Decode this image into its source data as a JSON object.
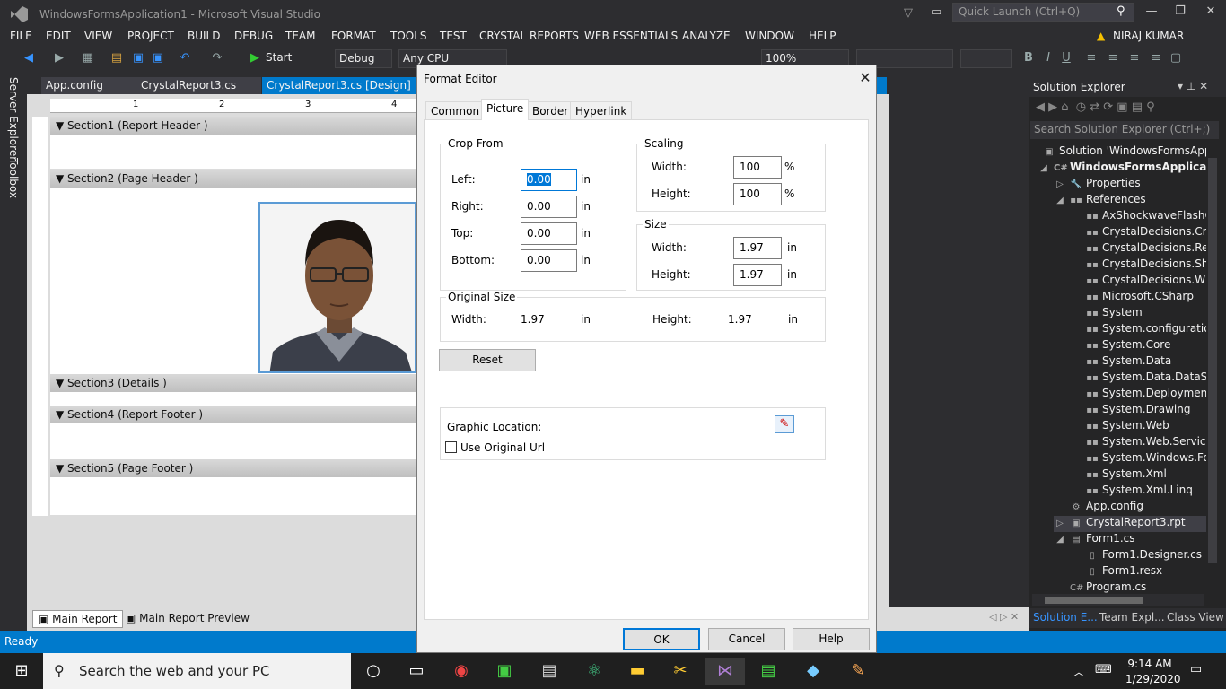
{
  "window": {
    "title": "WindowsFormsApplication1 - Microsoft Visual Studio",
    "quick_launch": "Quick Launch (Ctrl+Q)",
    "user": "NIRAJ KUMAR"
  },
  "menu": [
    "FILE",
    "EDIT",
    "VIEW",
    "PROJECT",
    "BUILD",
    "DEBUG",
    "TEAM",
    "FORMAT",
    "TOOLS",
    "TEST",
    "CRYSTAL REPORTS",
    "WEB ESSENTIALS",
    "ANALYZE",
    "WINDOW",
    "HELP"
  ],
  "toolbar": {
    "start": "Start",
    "config": "Debug",
    "platform": "Any CPU",
    "zoom": "100%"
  },
  "left_tabs": [
    "Server Explorer",
    "Toolbox"
  ],
  "doc_tabs": [
    "App.config",
    "CrystalReport3.cs",
    "CrystalReport3.cs [Design]"
  ],
  "ruler": [
    "1",
    "2",
    "3",
    "4"
  ],
  "sections": [
    "Section1 (Report Header  )",
    "Section2 (Page Header  )",
    "Section3 (Details  )",
    "Section4 (Report Footer  )",
    "Section5 (Page Footer  )"
  ],
  "bottom_tabs": [
    "Main Report",
    "Main Report Preview"
  ],
  "solution_explorer": {
    "title": "Solution Explorer",
    "search": "Search Solution Explorer (Ctrl+;)",
    "items": [
      "Solution 'WindowsFormsApplic",
      "WindowsFormsApplication",
      "Properties",
      "References",
      "AxShockwaveFlashO",
      "CrystalDecisions.Cry",
      "CrystalDecisions.Rep",
      "CrystalDecisions.Sha",
      "CrystalDecisions.Win",
      "Microsoft.CSharp",
      "System",
      "System.configuration",
      "System.Core",
      "System.Data",
      "System.Data.DataSet",
      "System.Deployment",
      "System.Drawing",
      "System.Web",
      "System.Web.Services",
      "System.Windows.Fo",
      "System.Xml",
      "System.Xml.Linq",
      "App.config",
      "CrystalReport3.rpt",
      "Form1.cs",
      "Form1.Designer.cs",
      "Form1.resx",
      "Program.cs"
    ],
    "bottom_tabs": [
      "Solution E...",
      "Team Expl...",
      "Class View"
    ]
  },
  "status": "Ready",
  "taskbar": {
    "search": "Search the web and your PC",
    "time": "9:14 AM",
    "date": "1/29/2020"
  },
  "dialog": {
    "title": "Format Editor",
    "tabs": [
      "Common",
      "Picture",
      "Border",
      "Hyperlink"
    ],
    "crop": {
      "label": "Crop From",
      "left_label": "Left:",
      "left": "0.00",
      "right_label": "Right:",
      "right": "0.00",
      "top_label": "Top:",
      "top": "0.00",
      "bottom_label": "Bottom:",
      "bottom": "0.00",
      "unit": "in"
    },
    "scaling": {
      "label": "Scaling",
      "width_label": "Width:",
      "width": "100",
      "height_label": "Height:",
      "height": "100",
      "unit": "%"
    },
    "size": {
      "label": "Size",
      "width_label": "Width:",
      "width": "1.97",
      "height_label": "Height:",
      "height": "1.97",
      "unit": "in"
    },
    "original": {
      "label": "Original Size",
      "width_label": "Width:",
      "width": "1.97",
      "height_label": "Height:",
      "height": "1.97",
      "unit": "in"
    },
    "reset": "Reset",
    "graphic_location": "Graphic Location:",
    "use_original_url": "Use Original Url",
    "ok": "OK",
    "cancel": "Cancel",
    "help": "Help"
  }
}
